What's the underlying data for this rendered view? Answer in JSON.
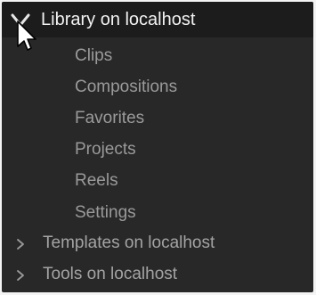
{
  "library": {
    "header_label": "Library on localhost",
    "header_icon": "chevron-down-icon",
    "items": [
      {
        "label": "Clips"
      },
      {
        "label": "Compositions"
      },
      {
        "label": "Favorites"
      },
      {
        "label": "Projects"
      },
      {
        "label": "Reels"
      },
      {
        "label": "Settings"
      }
    ]
  },
  "collapsed_nodes": [
    {
      "label": "Templates on localhost",
      "icon": "chevron-right-icon"
    },
    {
      "label": "Tools on localhost",
      "icon": "chevron-right-icon"
    }
  ],
  "colors": {
    "panel_background": "#282828",
    "header_background": "#1c1c1c",
    "header_text": "#f2f2f2",
    "child_text": "#9a9a9a",
    "collapsed_text": "#a3a3a3"
  }
}
